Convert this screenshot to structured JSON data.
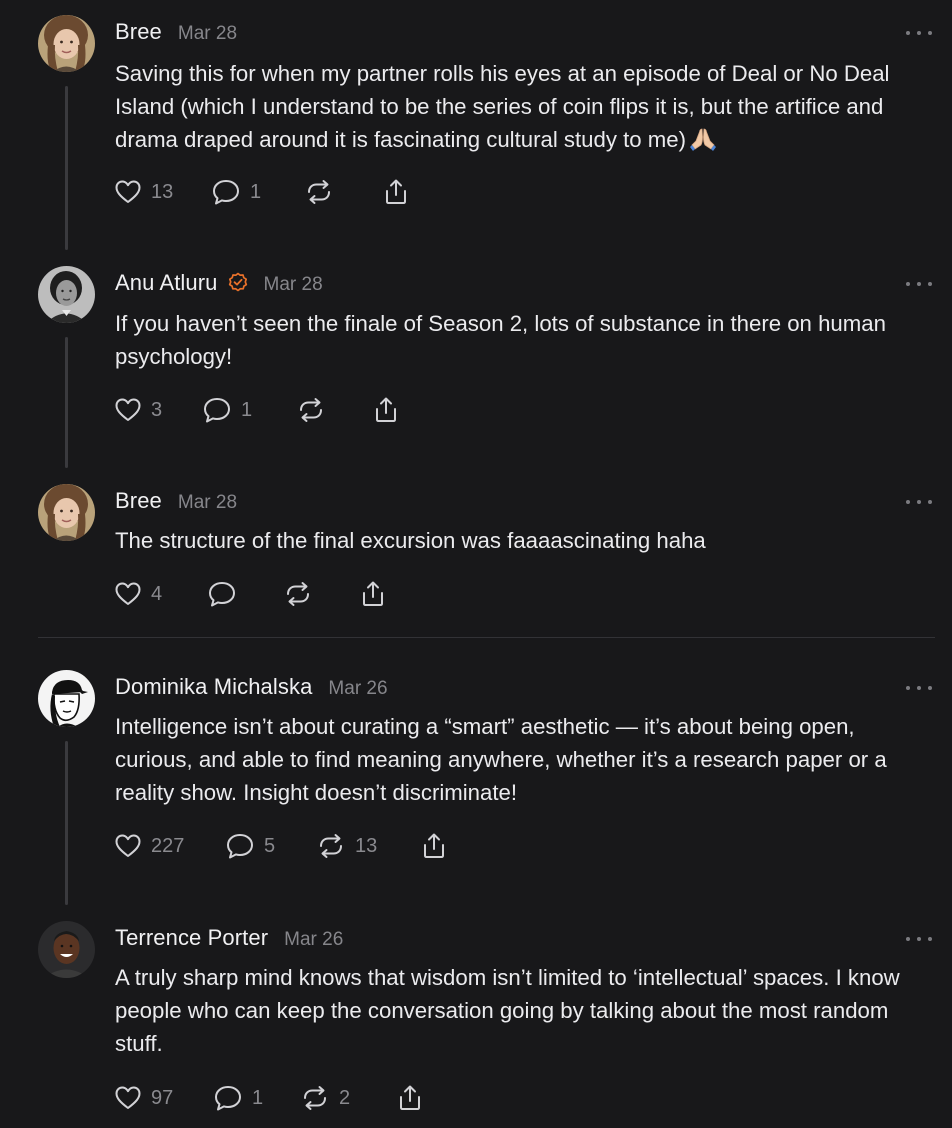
{
  "posts": [
    {
      "author": "Bree",
      "date": "Mar 28",
      "text": "Saving this for when my partner rolls his eyes at an episode of Deal or No Deal Island (which I understand to be the series of coin flips it is, but the artifice and drama draped around it is fascinating cultural study to me)",
      "emoji": "folded-hands-emoji",
      "likes": "13",
      "replies": "1",
      "reposts": ""
    },
    {
      "author": "Anu Atluru",
      "verified_icon": "verified-badge-icon",
      "verified_color": "#e8712a",
      "date": "Mar 28",
      "text": "If you haven’t seen the finale of Season 2, lots of substance in there on human psychology!",
      "likes": "3",
      "replies": "1",
      "reposts": ""
    },
    {
      "author": "Bree",
      "date": "Mar 28",
      "text": "The structure of the final excursion was faaaascinating haha",
      "likes": "4",
      "replies": "",
      "reposts": ""
    },
    {
      "author": "Dominika Michalska",
      "date": "Mar 26",
      "text": "Intelligence isn’t about curating a “smart” aesthetic — it’s about being open, curious, and able to find meaning anywhere, whether it’s a research paper or a reality show. Insight doesn’t discriminate!",
      "likes": "227",
      "replies": "5",
      "reposts": "13"
    },
    {
      "author": "Terrence Porter",
      "date": "Mar 26",
      "text": "A truly sharp mind knows that wisdom isn’t limited to ‘intellectual’ spaces. I know people who can keep the conversation going by talking about the most random stuff.",
      "likes": "97",
      "replies": "1",
      "reposts": "2"
    }
  ],
  "icons": {
    "like": "heart-icon",
    "reply": "comment-bubble-icon",
    "repost": "repost-arrows-icon",
    "share": "share-upload-icon",
    "more": "more-dots-icon"
  },
  "colors": {
    "background": "#18181a",
    "text": "#ebebee",
    "muted": "#86868b",
    "thread_line": "#3a3a3e",
    "verified": "#e8712a"
  }
}
